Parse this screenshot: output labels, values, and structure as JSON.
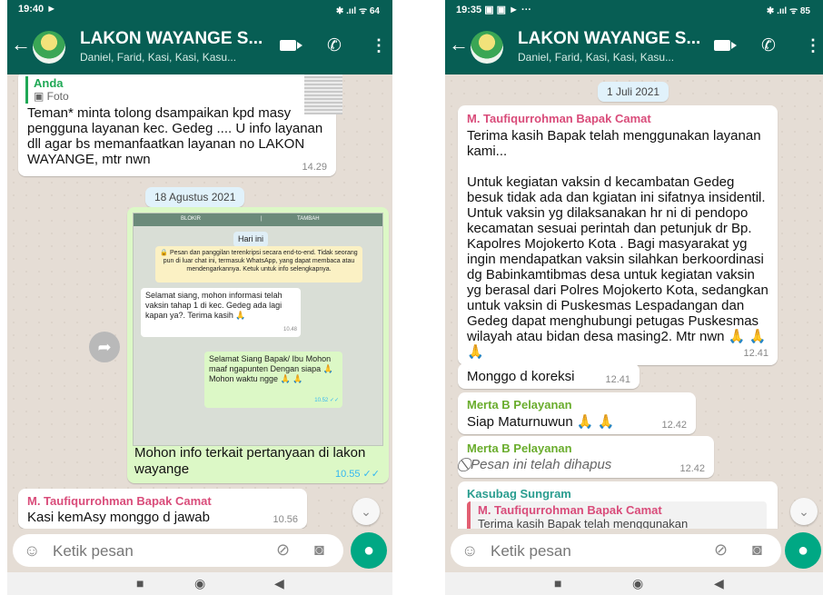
{
  "colors": {
    "header": "#075e54",
    "outgoing": "#dcf8c6",
    "incoming": "#ffffff",
    "accent": "#00a884",
    "quote_bar": "#e25f72"
  },
  "left": {
    "status_time": "19:40 ►",
    "status_icons": "✱ .ııl ᯤ 64",
    "title": "LAKON WAYANGE S...",
    "subtitle": "Daniel, Farid, Kasi, Kasi, Kasu...",
    "reply_sender": "Anda",
    "reply_type": "Foto",
    "msg1_text": "Teman* minta tolong dsampaikan kpd masy pengguna layanan kec. Gedeg .... U info layanan dll agar bs memanfaatkan layanan no LAKON WAYANGE, mtr nwn",
    "msg1_time": "14.29",
    "date_pill": "18 Agustus 2021",
    "embed": {
      "blokir": "BLOKIR",
      "tambah": "TAMBAH",
      "hari_ini": "Hari ini",
      "encryption": "🔒 Pesan dan panggilan terenkripsi secara end-to-end. Tidak seorang pun di luar chat ini, termasuk WhatsApp, yang dapat membaca atau mendengarkannya. Ketuk untuk info selengkapnya.",
      "in_text": "Selamat siang, mohon informasi telah vaksin tahap 1 di kec. Gedeg ada lagi kapan ya?. Terima kasih 🙏",
      "in_time": "10.48",
      "out_text": "Selamat Siang Bapak/ Ibu Mohon maaf ngapunten Dengan siapa 🙏 Mohon waktu ngge 🙏 🙏",
      "out_time": "10.52 ✓✓"
    },
    "msg2_text": "Mohon info terkait pertanyaan di lakon wayange",
    "msg2_time": "10.55 ✓✓",
    "msg3_sender": "M. Taufiqurrohman Bapak Camat",
    "msg3_text": "Kasi kemAsy monggo d jawab",
    "msg3_time": "10.56",
    "input_placeholder": "Ketik pesan"
  },
  "right": {
    "status_time": "19:35 ▣ ▣ ► ···",
    "status_icons": "✱ .ııl ᯤ 85",
    "title": "LAKON WAYANGE S...",
    "subtitle": "Daniel, Farid, Kasi, Kasi, Kasu...",
    "date_pill": "1 Juli 2021",
    "msg1_sender": "M. Taufiqurrohman Bapak Camat",
    "msg1_text_a": "Terima kasih Bapak telah menggunakan layanan kami...",
    "msg1_text_b": "Untuk kegiatan vaksin d kecambatan Gedeg besuk tidak ada dan kgiatan ini sifatnya insidentil. Untuk vaksin yg dilaksanakan hr ni di pendopo kecamatan sesuai perintah dan petunjuk dr Bp. Kapolres Mojokerto Kota . Bagi masyarakat yg ingin mendapatkan vaksin silahkan berkoordinasi dg Babinkamtibmas desa untuk kegiatan vaksin yg berasal dari Polres Mojokerto Kota, sedangkan untuk vaksin di Puskesmas Lespadangan dan Gedeg dapat menghubungi petugas Puskesmas wilayah atau bidan desa masing2. Mtr nwn 🙏 🙏 🙏",
    "msg1_time": "12.41",
    "msg2_text": "Monggo d koreksi",
    "msg2_time": "12.41",
    "msg3_sender": "Merta B Pelayanan",
    "msg3_text": "Siap Maturnuwun 🙏 🙏",
    "msg3_time": "12.42",
    "msg4_sender": "Merta B Pelayanan",
    "msg4_text": "Pesan ini telah dihapus",
    "msg4_time": "12.42",
    "msg5_sender": "Kasubag Sungram",
    "msg5_quote_sender": "M. Taufiqurrohman Bapak Camat",
    "msg5_quote_text": "Terima kasih Bapak telah menggunakan",
    "input_placeholder": "Ketik pesan"
  },
  "icons": {
    "back": "arrow-left",
    "group": "group-avatar",
    "video": "video-camera",
    "call": "phone",
    "more": "kebab-menu",
    "emoji": "emoji",
    "attach": "paperclip",
    "camera": "camera",
    "mic": "microphone",
    "forward": "forward-arrow",
    "scroll": "chevron-down"
  }
}
